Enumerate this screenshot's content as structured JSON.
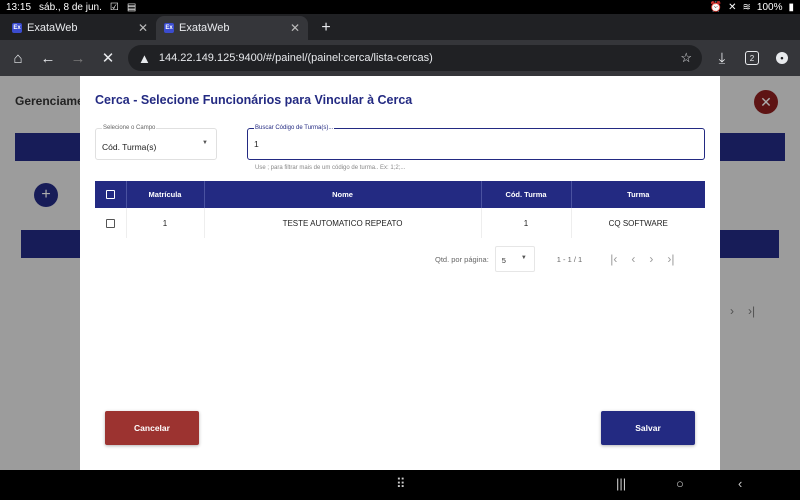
{
  "status_bar": {
    "time": "13:15",
    "date": "sáb., 8 de jun.",
    "battery": "100%"
  },
  "browser": {
    "tabs": [
      {
        "title": "ExataWeb",
        "favicon": "Ex"
      },
      {
        "title": "ExataWeb",
        "favicon": "Ex"
      }
    ],
    "url": "144.22.149.125:9400/#/painel/(painel:cerca/lista-cercas)",
    "tab_count": "2"
  },
  "background": {
    "title": "Gerenciame"
  },
  "dialog": {
    "title": "Cerca - Selecione Funcionários para Vincular à Cerca",
    "field_select": {
      "label": "Selecione o Campo",
      "value": "Cód. Turma(s)"
    },
    "search": {
      "label": "Buscar Código de Turma(s)...",
      "value": "1",
      "hint": "Use ; para filtrar mais de um código de turma.. Ex: 1;2;..."
    },
    "table": {
      "columns": [
        "Matrícula",
        "Nome",
        "Cód. Turma",
        "Turma"
      ],
      "rows": [
        {
          "matricula": "1",
          "nome": "TESTE AUTOMATICO REPEATO",
          "cod_turma": "1",
          "turma": "CQ SOFTWARE"
        }
      ]
    },
    "paginator": {
      "label": "Qtd. por página:",
      "page_size": "5",
      "range": "1 - 1 / 1"
    },
    "buttons": {
      "cancel": "Cancelar",
      "save": "Salvar"
    }
  },
  "colors": {
    "primary": "#232a82",
    "danger": "#9c3330"
  }
}
